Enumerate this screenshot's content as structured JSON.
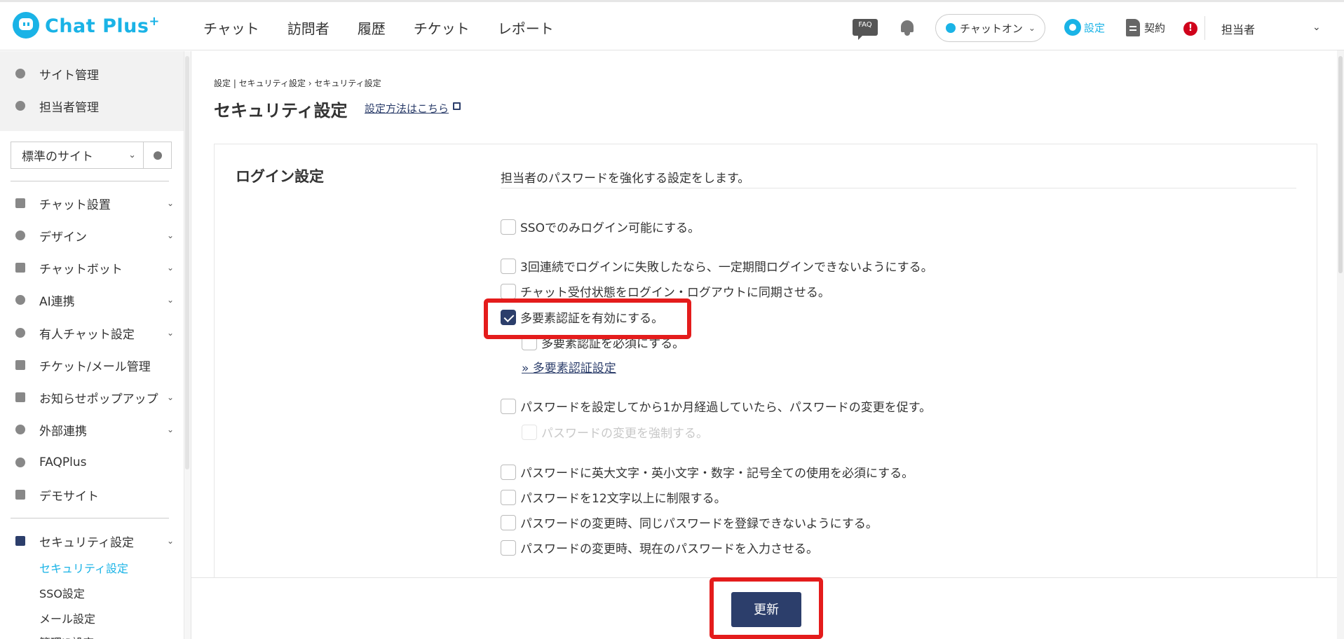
{
  "header": {
    "logo_text": "Chat Plus",
    "logo_sup": "+",
    "nav": [
      "チャット",
      "訪問者",
      "履歴",
      "チケット",
      "レポート"
    ],
    "faq_label": "FAQ",
    "chat_status": "チャットオン",
    "settings_label": "設定",
    "contract_label": "契約",
    "alert_label": "!",
    "user_label": "担当者"
  },
  "sidebar": {
    "top_items": [
      "サイト管理",
      "担当者管理"
    ],
    "site_select": "標準のサイト",
    "menu": [
      "チャット設置",
      "デザイン",
      "チャットボット",
      "AI連携",
      "有人チャット設定",
      "チケット/メール管理",
      "お知らせポップアップ",
      "外部連携",
      "FAQPlus",
      "デモサイト"
    ],
    "security_label": "セキュリティ設定",
    "security_sub": [
      "セキュリティ設定",
      "SSO設定",
      "メール設定",
      "管理IP設定"
    ]
  },
  "main": {
    "breadcrumb": "設定 | セキュリティ設定 › セキュリティ設定",
    "title": "セキュリティ設定",
    "help_link": "設定方法はこちら",
    "section_title": "ログイン設定",
    "section_desc": "担当者のパスワードを強化する設定をします。",
    "options": [
      {
        "label": "SSOでのみログイン可能にする。",
        "checked": false
      },
      {
        "label": "3回連続でログインに失敗したなら、一定期間ログインできないようにする。",
        "checked": false
      },
      {
        "label": "チャット受付状態をログイン・ログアウトに同期させる。",
        "checked": false
      },
      {
        "label": "多要素認証を有効にする。",
        "checked": true
      },
      {
        "label": "多要素認証を必須にする。",
        "checked": false
      },
      {
        "label": "パスワードを設定してから1か月経過していたら、パスワードの変更を促す。",
        "checked": false
      },
      {
        "label": "パスワードの変更を強制する。",
        "checked": false,
        "disabled": true
      },
      {
        "label": "パスワードに英大文字・英小文字・数字・記号全ての使用を必須にする。",
        "checked": false
      },
      {
        "label": "パスワードを12文字以上に制限する。",
        "checked": false
      },
      {
        "label": "パスワードの変更時、同じパスワードを登録できないようにする。",
        "checked": false
      },
      {
        "label": "パスワードの変更時、現在のパスワードを入力させる。",
        "checked": false
      }
    ],
    "mfa_link": "» 多要素認証設定",
    "update_button": "更新"
  },
  "colors": {
    "brand": "#1ab3e6",
    "navy": "#2c3e6b",
    "highlight": "#e41c1c"
  }
}
